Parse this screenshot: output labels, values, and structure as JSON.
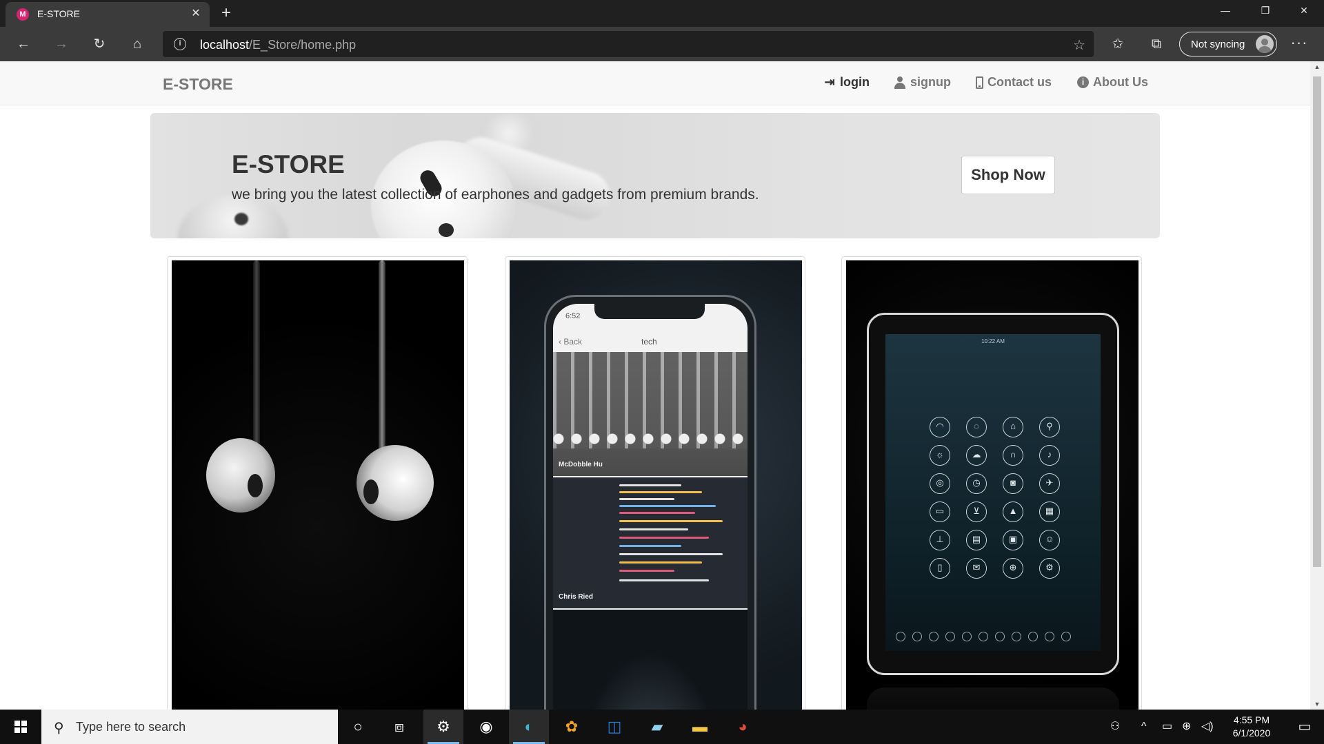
{
  "browser": {
    "tab_title": "E-STORE",
    "favicon_letter": "M",
    "url_host": "localhost",
    "url_path": "/E_Store/home.php",
    "sync_label": "Not syncing"
  },
  "site": {
    "brand": "E-STORE",
    "nav": {
      "login": "login",
      "signup": "signup",
      "contact": "Contact us",
      "about": "About Us"
    },
    "hero": {
      "title": "E-STORE",
      "text": "we bring you the latest collection of earphones and gadgets from premium brands.",
      "button": "Shop Now"
    },
    "products": [
      {
        "image": "earphones"
      },
      {
        "image": "phone",
        "screen_time": "6:52",
        "screen_back": "Back",
        "screen_title": "tech",
        "caption1": "McDobble Hu",
        "caption2": "Chris Ried"
      },
      {
        "image": "tablet",
        "screen_time": "10:22 AM"
      }
    ]
  },
  "taskbar": {
    "search_placeholder": "Type here to search",
    "time": "4:55 PM",
    "date": "6/1/2020"
  }
}
